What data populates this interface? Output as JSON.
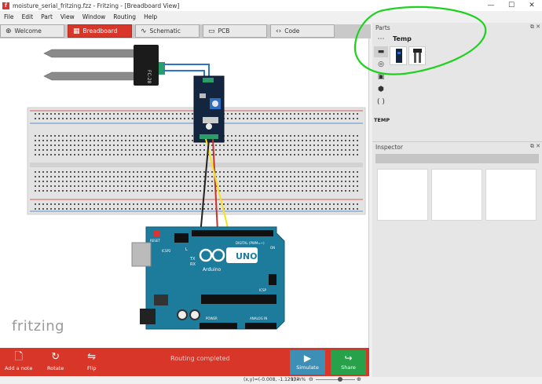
{
  "window": {
    "title": "moisture_serial_fritzing.fzz - Fritzing - [Breadboard View]",
    "app_icon": "f",
    "minimize": "—",
    "maximize": "☐",
    "close": "✕"
  },
  "menu": [
    "File",
    "Edit",
    "Part",
    "View",
    "Window",
    "Routing",
    "Help"
  ],
  "tabs": [
    {
      "label": "Welcome",
      "icon": "⊕"
    },
    {
      "label": "Breadboard",
      "icon": "▦"
    },
    {
      "label": "Schematic",
      "icon": "∿"
    },
    {
      "label": "PCB",
      "icon": "▭"
    },
    {
      "label": "Code",
      "icon": "‹›"
    }
  ],
  "canvas": {
    "logo": "fritzing",
    "sensor_label": "FC-28",
    "arduino_label": "UNO",
    "arduino_brand": "Arduino",
    "reset_label": "RESET",
    "icsp_label": "ICSP2",
    "digital_label": "DIGITAL (PWM=~)",
    "analog_label": "ANALOG IN",
    "power_label": "POWER",
    "icsp1_label": "ICSP",
    "on_label": "ON",
    "tx_label": "TX",
    "rx_label": "RX",
    "l_label": "L",
    "colors": {
      "arduino": "#1d7b9c",
      "breadboard": "#e3e3e3",
      "wire_yellow": "#f4e31c",
      "wire_red": "#c8352c",
      "wire_black": "#222222",
      "wire_blue": "#2e74c9",
      "annotation": "#1fd11f"
    }
  },
  "toolbar": {
    "add_note": "Add a note",
    "rotate": "Rotate",
    "flip": "Flip",
    "status": "Routing completed",
    "simulate": "Simulate",
    "share": "Share"
  },
  "statusbar": {
    "coords": "(x,y)=(-0.008, -1.129) in",
    "zoom": "134 %"
  },
  "parts": {
    "title": "Parts",
    "bin_header": "Temp",
    "bin_label": "TEMP",
    "search_icon": "search-icon"
  },
  "inspector": {
    "title": "Inspector"
  }
}
